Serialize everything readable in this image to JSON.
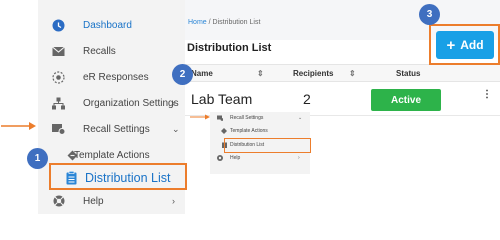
{
  "sidebar": {
    "items": [
      {
        "label": "Dashboard",
        "icon": "dashboard-icon",
        "chevron": ""
      },
      {
        "label": "Recalls",
        "icon": "mail-icon",
        "chevron": ""
      },
      {
        "label": "eR Responses",
        "icon": "responses-icon",
        "chevron": ""
      },
      {
        "label": "Organization Settings",
        "icon": "org-icon",
        "chevron": "›"
      },
      {
        "label": "Recall Settings",
        "icon": "recall-settings-icon",
        "chevron": "⌄"
      },
      {
        "label": "Template Actions",
        "icon": "template-icon",
        "chevron": ""
      },
      {
        "label": "Distribution List",
        "icon": "clipboard-icon",
        "chevron": ""
      },
      {
        "label": "Help",
        "icon": "help-icon",
        "chevron": "›"
      }
    ]
  },
  "breadcrumb": {
    "home": "Home",
    "separator": "/",
    "current": "Distribution List"
  },
  "page_title": "Distribution List",
  "add_button": {
    "label": "Add",
    "icon": "plus-icon"
  },
  "table": {
    "columns": [
      "Name",
      "Recipients",
      "Status"
    ],
    "sort_glyph": "⇕",
    "rows": [
      {
        "name": "Lab Team",
        "recipients": "2",
        "status": "Active",
        "menu": "⋮"
      }
    ]
  },
  "inset": {
    "items": [
      {
        "label": "Recall Settings",
        "chevron": "⌄"
      },
      {
        "label": "Template Actions",
        "chevron": ""
      },
      {
        "label": "Distribution List",
        "chevron": ""
      },
      {
        "label": "Help",
        "chevron": "›"
      }
    ]
  },
  "markers": {
    "one": "1",
    "two": "2",
    "three": "3"
  },
  "colors": {
    "highlight": "#ec7d2c",
    "marker": "#3f6fc0",
    "accent": "#19a0e6",
    "active_status": "#2db34a",
    "link": "#1a73c7"
  }
}
